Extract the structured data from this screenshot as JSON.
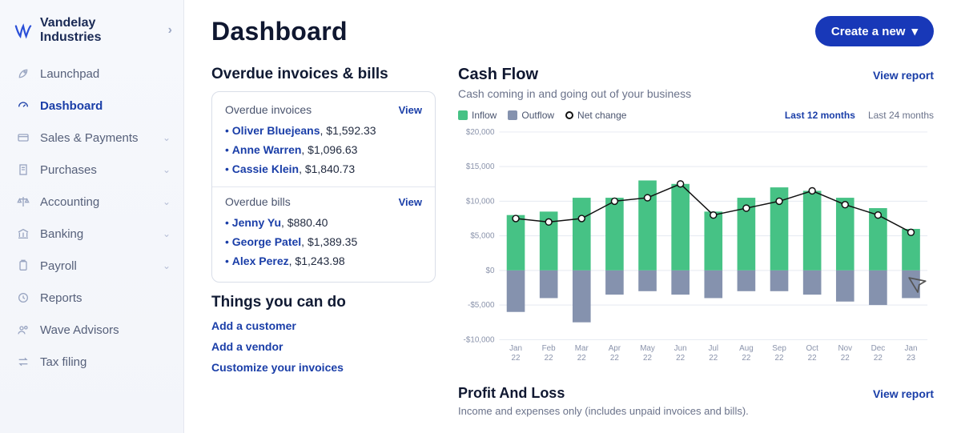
{
  "org": {
    "name": "Vandelay Industries"
  },
  "sidebar": {
    "items": [
      {
        "label": "Launchpad",
        "icon": "rocket-icon",
        "expandable": false
      },
      {
        "label": "Dashboard",
        "icon": "gauge-icon",
        "expandable": false,
        "active": true
      },
      {
        "label": "Sales & Payments",
        "icon": "card-icon",
        "expandable": true
      },
      {
        "label": "Purchases",
        "icon": "receipt-icon",
        "expandable": true
      },
      {
        "label": "Accounting",
        "icon": "scale-icon",
        "expandable": true
      },
      {
        "label": "Banking",
        "icon": "bank-icon",
        "expandable": true
      },
      {
        "label": "Payroll",
        "icon": "clipboard-icon",
        "expandable": true
      },
      {
        "label": "Reports",
        "icon": "clock-icon",
        "expandable": false
      },
      {
        "label": "Wave Advisors",
        "icon": "people-icon",
        "expandable": false
      },
      {
        "label": "Tax filing",
        "icon": "transfer-icon",
        "expandable": false
      }
    ]
  },
  "page": {
    "title": "Dashboard",
    "create_button": "Create a new"
  },
  "overdue": {
    "heading": "Overdue invoices & bills",
    "invoices": {
      "title": "Overdue invoices",
      "view": "View",
      "items": [
        {
          "name": "Oliver Bluejeans",
          "amount": "$1,592.33"
        },
        {
          "name": "Anne Warren",
          "amount": "$1,096.63"
        },
        {
          "name": "Cassie Klein",
          "amount": "$1,840.73"
        }
      ]
    },
    "bills": {
      "title": "Overdue bills",
      "view": "View",
      "items": [
        {
          "name": "Jenny Yu",
          "amount": "$880.40"
        },
        {
          "name": "George Patel",
          "amount": "$1,389.35"
        },
        {
          "name": "Alex Perez",
          "amount": "$1,243.98"
        }
      ]
    }
  },
  "things": {
    "heading": "Things you can do",
    "links": [
      "Add a customer",
      "Add a vendor",
      "Customize your invoices"
    ]
  },
  "cashflow": {
    "title": "Cash Flow",
    "subtitle": "Cash coming in and going out of your business",
    "view_report": "View report",
    "legend": {
      "inflow": "Inflow",
      "outflow": "Outflow",
      "net": "Net change"
    },
    "ranges": {
      "twelve": "Last 12 months",
      "twentyfour": "Last 24 months",
      "active": "twelve"
    }
  },
  "pnl": {
    "title": "Profit And Loss",
    "subtitle": "Income and expenses only (includes unpaid invoices and bills).",
    "view_report": "View report"
  },
  "chart_data": {
    "type": "bar",
    "title": "Cash Flow",
    "ylabel": "",
    "xlabel": "",
    "ylim": [
      -10000,
      20000
    ],
    "yticks": [
      -10000,
      -5000,
      0,
      5000,
      10000,
      15000,
      20000
    ],
    "ytick_labels": [
      "-$10,000",
      "-$5,000",
      "$0",
      "$5,000",
      "$10,000",
      "$15,000",
      "$20,000"
    ],
    "categories": [
      "Jan 22",
      "Feb 22",
      "Mar 22",
      "Apr 22",
      "May 22",
      "Jun 22",
      "Jul 22",
      "Aug 22",
      "Sep 22",
      "Oct 22",
      "Nov 22",
      "Dec 22",
      "Jan 23"
    ],
    "series": [
      {
        "name": "Inflow",
        "values": [
          8000,
          8500,
          10500,
          10500,
          13000,
          12500,
          8500,
          10500,
          12000,
          11500,
          10500,
          9000,
          6000
        ]
      },
      {
        "name": "Outflow",
        "values": [
          -6000,
          -4000,
          -7500,
          -3500,
          -3000,
          -3500,
          -4000,
          -3000,
          -3000,
          -3500,
          -4500,
          -5000,
          -4000
        ]
      },
      {
        "name": "Net change",
        "values": [
          7500,
          7000,
          7500,
          10000,
          10500,
          12500,
          8000,
          9000,
          10000,
          11500,
          9500,
          8000,
          5500
        ]
      }
    ]
  },
  "colors": {
    "inflow": "#46c285",
    "outflow": "#8592ae",
    "accent": "#1a3ea8"
  }
}
